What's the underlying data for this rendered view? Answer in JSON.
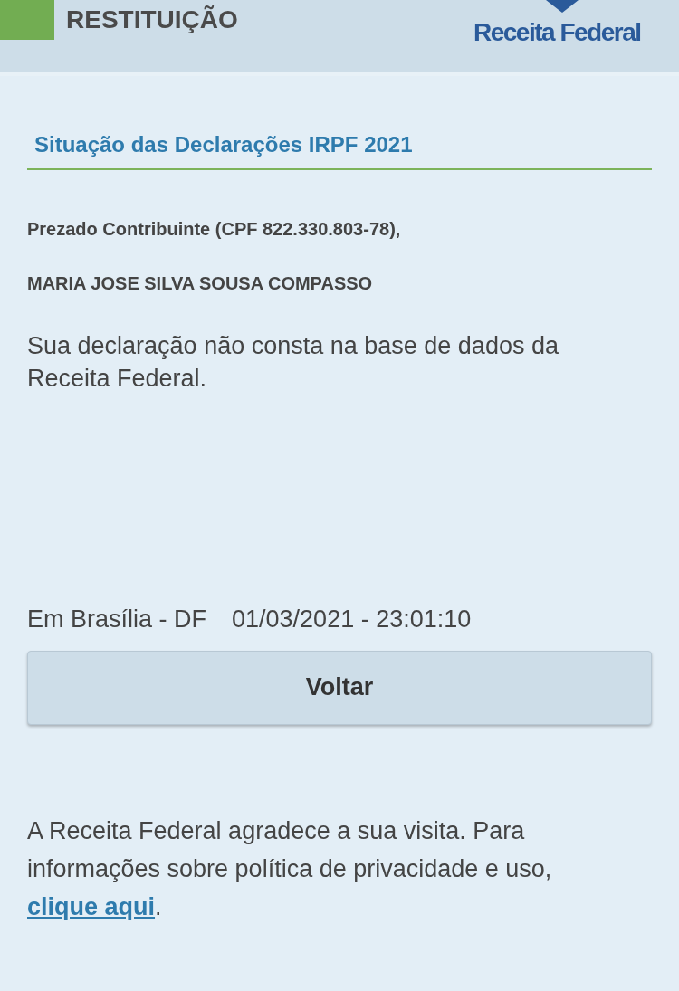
{
  "header": {
    "title": "RESTITUIÇÃO",
    "logo_text": "Receita Federal"
  },
  "section_title": "Situação das Declarações IRPF 2021",
  "greeting": "Prezado Contribuinte (CPF 822.330.803-78),",
  "taxpayer_name": "MARIA JOSE SILVA SOUSA COMPASSO",
  "message": "Sua declaração não consta na base de dados da Receita Federal.",
  "place": "Em Brasília - DF",
  "timestamp": "01/03/2021 - 23:01:10",
  "back_button": "Voltar",
  "footer": {
    "text": "A Receita Federal agradece a sua visita. Para informações sobre política de privacidade e uso,",
    "link": "clique aqui",
    "after_link": "."
  }
}
